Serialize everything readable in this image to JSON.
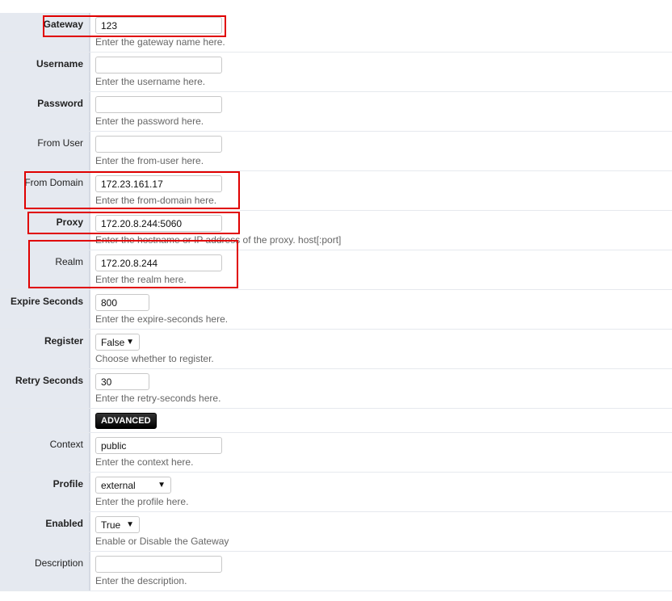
{
  "fields": [
    {
      "label": "Gateway",
      "required": true,
      "type": "text",
      "value": "123",
      "hint": "Enter the gateway name here."
    },
    {
      "label": "Username",
      "required": true,
      "type": "text",
      "value": "",
      "hint": "Enter the username here."
    },
    {
      "label": "Password",
      "required": true,
      "type": "text",
      "value": "",
      "hint": "Enter the password here."
    },
    {
      "label": "From User",
      "required": false,
      "type": "text",
      "value": "",
      "hint": "Enter the from-user here."
    },
    {
      "label": "From Domain",
      "required": false,
      "type": "text",
      "value": "172.23.161.17",
      "hint": "Enter the from-domain here."
    },
    {
      "label": "Proxy",
      "required": true,
      "type": "text",
      "value": "172.20.8.244:5060",
      "hint": "Enter the hostname or IP address of the proxy. host[:port]"
    },
    {
      "label": "Realm",
      "required": false,
      "type": "text",
      "value": "172.20.8.244",
      "hint": "Enter the realm here."
    },
    {
      "label": "Expire Seconds",
      "required": true,
      "type": "short",
      "value": "800",
      "hint": "Enter the expire-seconds here."
    },
    {
      "label": "Register",
      "required": true,
      "type": "select",
      "value": "False",
      "hint": "Choose whether to register."
    },
    {
      "label": "Retry Seconds",
      "required": true,
      "type": "short",
      "value": "30",
      "hint": "Enter the retry-seconds here."
    },
    {
      "type": "advanced",
      "button": "ADVANCED"
    },
    {
      "label": "Context",
      "required": false,
      "type": "text",
      "value": "public",
      "hint": "Enter the context here."
    },
    {
      "label": "Profile",
      "required": true,
      "type": "select-wide",
      "value": "external",
      "hint": "Enter the profile here."
    },
    {
      "label": "Enabled",
      "required": true,
      "type": "select",
      "value": "True",
      "hint": "Enable or Disable the Gateway"
    },
    {
      "label": "Description",
      "required": false,
      "type": "text",
      "value": "",
      "hint": "Enter the description."
    }
  ],
  "highlight_color": "#e00000",
  "dropdown_icon": "▼"
}
